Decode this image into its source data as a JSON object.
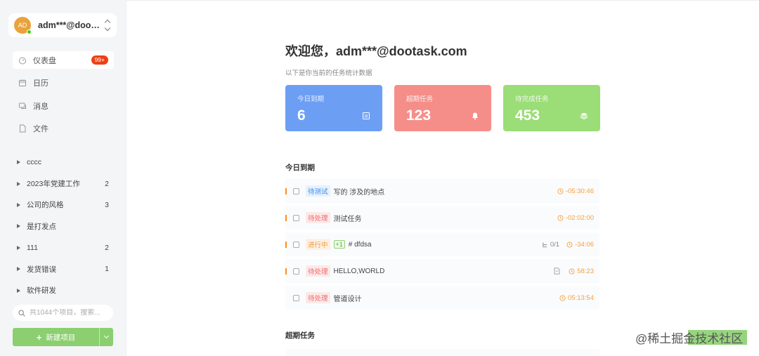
{
  "account": {
    "initials": "AD",
    "name": "adm***@dootask.com"
  },
  "menu": [
    {
      "label": "仪表盘",
      "badge": "99+",
      "icon": "dashboard-icon",
      "active": true
    },
    {
      "label": "日历",
      "icon": "calendar-icon"
    },
    {
      "label": "消息",
      "icon": "message-icon"
    },
    {
      "label": "文件",
      "icon": "file-icon"
    }
  ],
  "projects": [
    {
      "name": "cccc",
      "count": ""
    },
    {
      "name": "2023年党建工作",
      "count": "2"
    },
    {
      "name": "公司的风格",
      "count": "3"
    },
    {
      "name": "是打发点",
      "count": ""
    },
    {
      "name": "111",
      "count": "2"
    },
    {
      "name": "发货错误",
      "count": "1"
    },
    {
      "name": "软件研发",
      "count": ""
    }
  ],
  "search": {
    "placeholder": "共1044个项目，搜索..."
  },
  "new_project": {
    "label": "新建项目"
  },
  "main": {
    "welcome": "欢迎您，adm***@dootask.com",
    "subtitle": "以下是你当前的任务统计数据",
    "cards": [
      {
        "label": "今日到期",
        "value": "6",
        "icon": "calendar-list-icon",
        "color": "#6c9ff4"
      },
      {
        "label": "超期任务",
        "value": "123",
        "icon": "bell-icon",
        "color": "#f58e89"
      },
      {
        "label": "待完成任务",
        "value": "453",
        "icon": "layers-icon",
        "color": "#9bdd76"
      }
    ],
    "today_title": "今日到期",
    "overdue_title": "超期任务",
    "tasks": [
      {
        "status": "待测试",
        "name": "写的 涉及的地点",
        "time": "-05:30:46"
      },
      {
        "status": "待处理",
        "name": "测试任务",
        "time": "-02:02:00"
      },
      {
        "status": "进行中",
        "extra": "+1",
        "name": "# dfdsa",
        "sub": "0/1",
        "time": "-34:06"
      },
      {
        "status": "待处理",
        "name": "HELLO,WORLD",
        "time": "58:23"
      },
      {
        "status": "待处理",
        "name": "管道设计",
        "time": "05:13:54"
      }
    ]
  },
  "watermark": "@稀土掘金技术社区"
}
